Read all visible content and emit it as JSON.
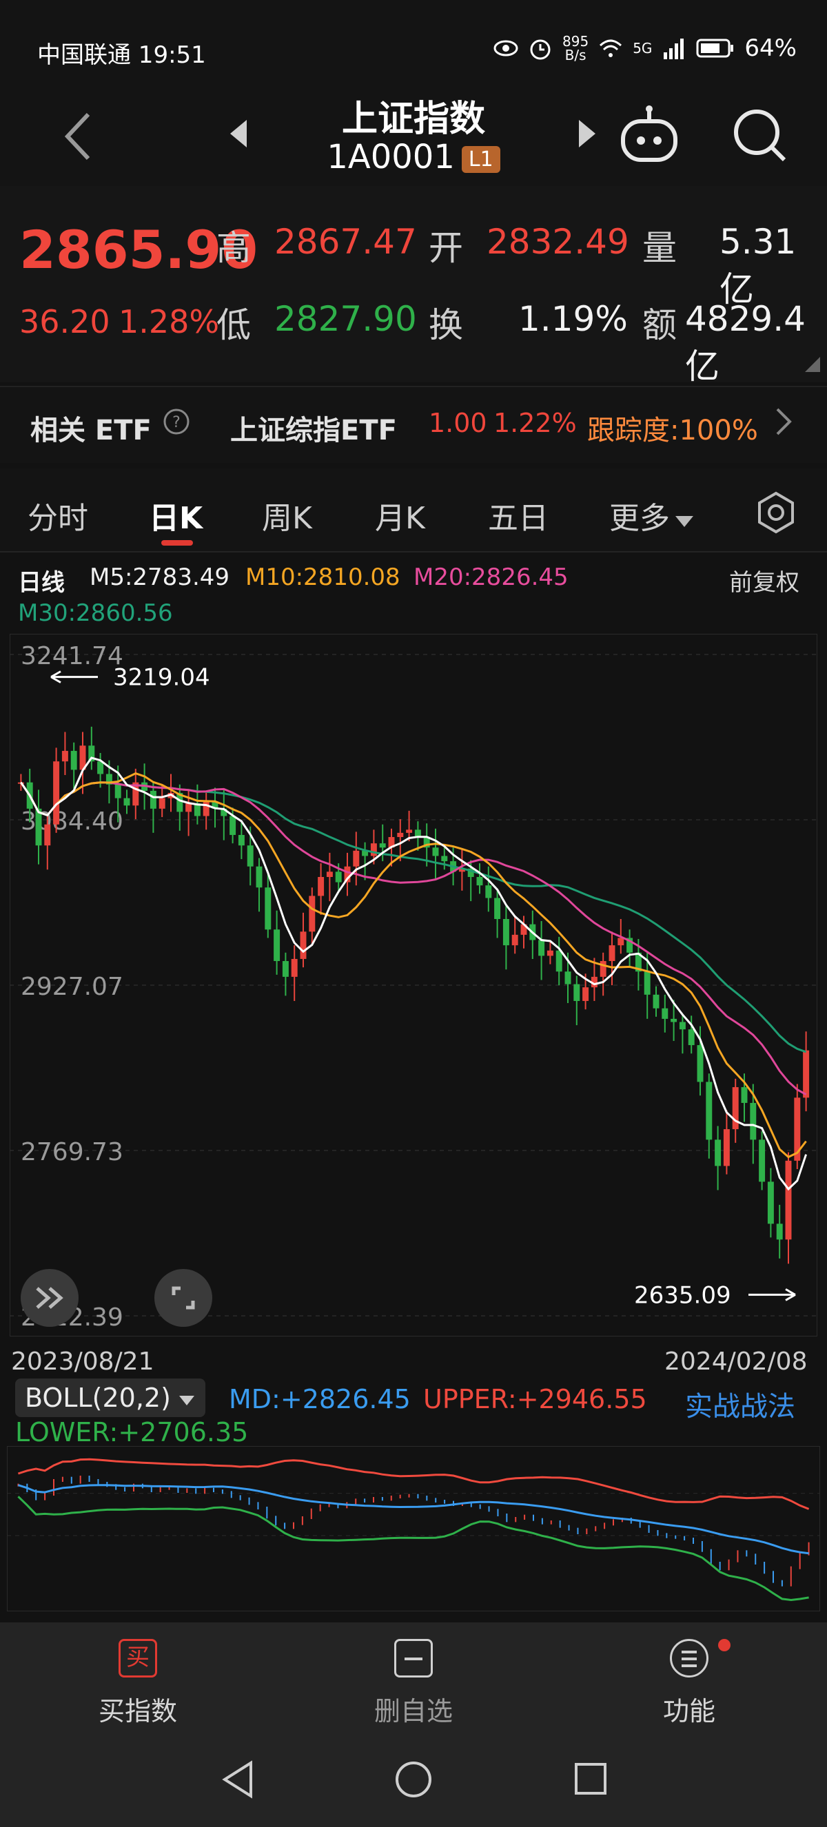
{
  "status": {
    "carrier": "中国联通 19:51",
    "net_speed_top": "895",
    "net_speed_bottom": "B/s",
    "signal": "5G",
    "battery": "64%"
  },
  "header": {
    "title": "上证指数",
    "code": "1A0001",
    "level_badge": "L1"
  },
  "quote": {
    "price": "2865.90",
    "change": "36.20",
    "change_pct": "1.28%",
    "high_label": "高",
    "high": "2867.47",
    "low_label": "低",
    "low": "2827.90",
    "open_label": "开",
    "open": "2832.49",
    "turnover_label": "换",
    "turnover": "1.19%",
    "volume_label": "量",
    "volume": "5.31亿",
    "amount_label": "额",
    "amount": "4829.4亿"
  },
  "etf": {
    "label": "相关 ETF",
    "name": "上证综指ETF",
    "price": "1.00",
    "pct": "1.22%",
    "tracking": "跟踪度:100%"
  },
  "tabs": [
    "分时",
    "日K",
    "周K",
    "月K",
    "五日",
    "更多"
  ],
  "ma_line": {
    "period": "日线",
    "m5": "M5:2783.49",
    "m10": "M10:2810.08",
    "m20": "M20:2826.45",
    "m30": "M30:2860.56",
    "adjust": "前复权"
  },
  "chart_data": {
    "type": "candlestick",
    "y_ticks": [
      "3241.74",
      "3084.40",
      "2927.07",
      "2769.73",
      "2612.39"
    ],
    "x_start": "2023/08/21",
    "x_end": "2024/02/08",
    "high_mark": "3219.04",
    "low_mark": "2635.09",
    "ylim": [
      2612.39,
      3241.74
    ],
    "closes": [
      3120,
      3095,
      3060,
      3080,
      3140,
      3150,
      3132,
      3155,
      3140,
      3128,
      3118,
      3105,
      3098,
      3120,
      3112,
      3095,
      3105,
      3110,
      3092,
      3100,
      3088,
      3102,
      3095,
      3088,
      3070,
      3060,
      3040,
      3020,
      2980,
      2950,
      2935,
      2952,
      2978,
      3012,
      3030,
      3035,
      3025,
      3040,
      3055,
      3050,
      3062,
      3058,
      3068,
      3072,
      3075,
      3068,
      3058,
      3050,
      3045,
      3035,
      3038,
      3030,
      3022,
      3010,
      2990,
      2965,
      2975,
      2985,
      2970,
      2955,
      2960,
      2940,
      2928,
      2912,
      2925,
      2935,
      2950,
      2965,
      2972,
      2958,
      2940,
      2918,
      2905,
      2895,
      2892,
      2885,
      2870,
      2835,
      2780,
      2755,
      2790,
      2830,
      2815,
      2780,
      2740,
      2700,
      2685,
      2760,
      2820,
      2865
    ]
  },
  "boll": {
    "label": "BOLL(20,2)",
    "md": "MD:+2826.45",
    "upper": "UPPER:+2946.55",
    "lower": "LOWER:+2706.35",
    "link": "实战战法"
  },
  "bottom_nav": [
    {
      "label": "买指数",
      "icon": "买"
    },
    {
      "label": "删自选"
    },
    {
      "label": "功能"
    }
  ]
}
